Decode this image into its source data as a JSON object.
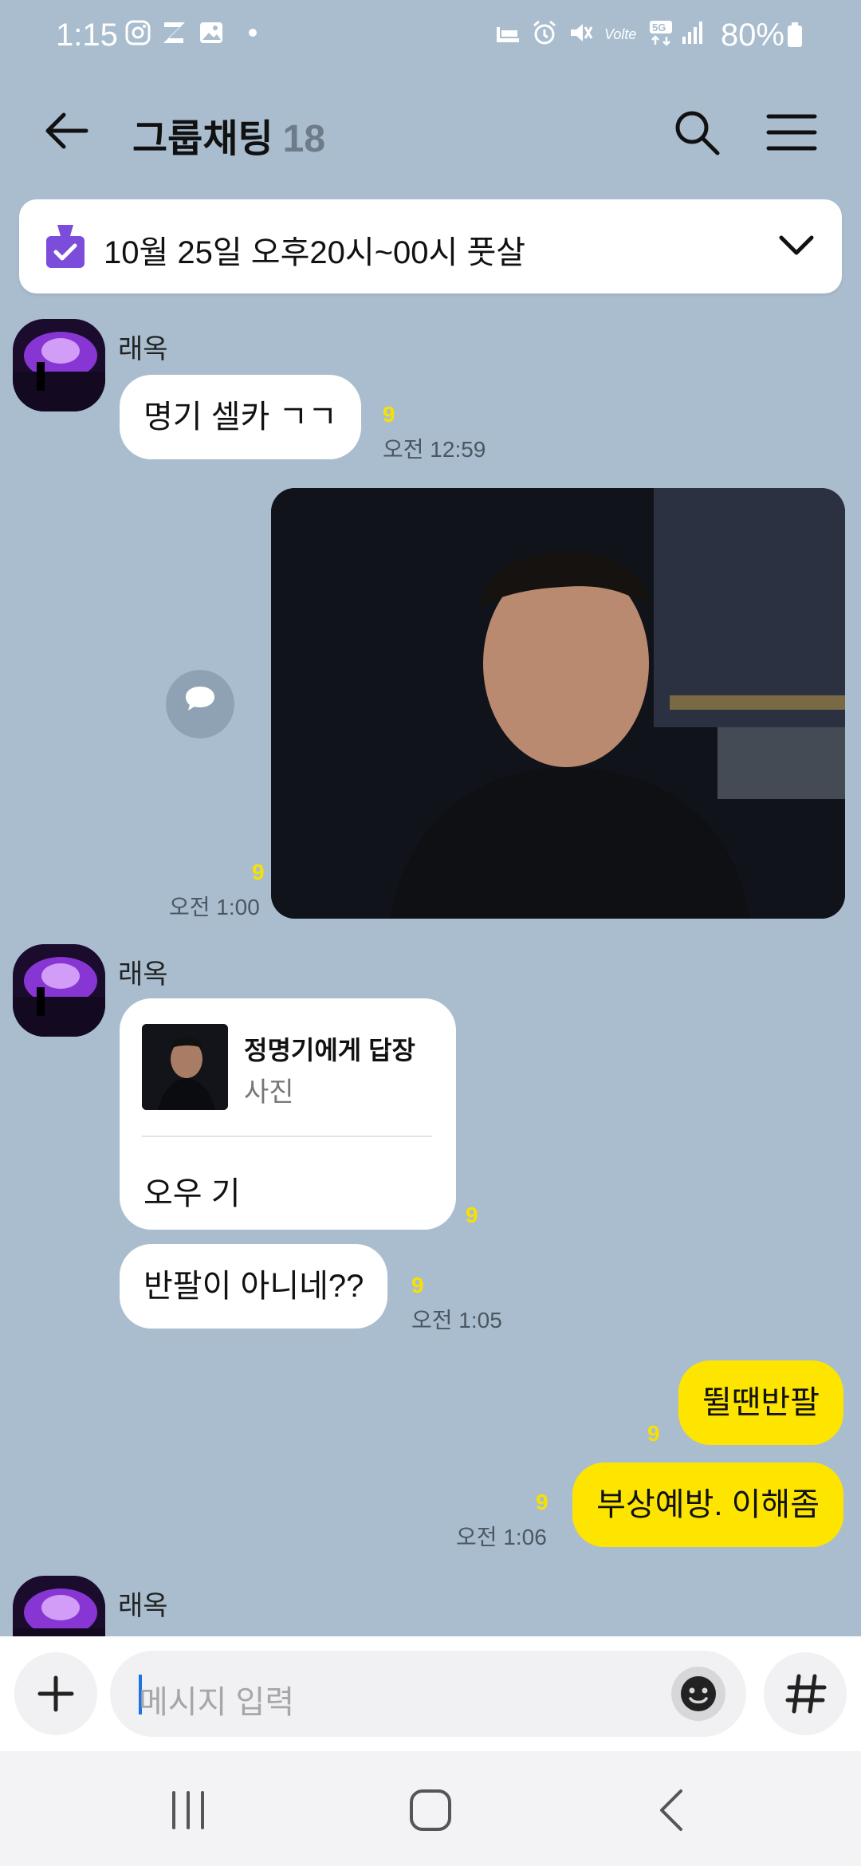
{
  "status_bar": {
    "time": "1:15",
    "battery": "80%"
  },
  "header": {
    "title": "그룹채팅",
    "member_count": "18"
  },
  "notice": {
    "text": "10월 25일 오후20시~00시 풋살"
  },
  "messages": [
    {
      "sender": "래옥",
      "text": "명기 셀카 ㄱㄱ",
      "unread": "9",
      "time": "오전 12:59"
    },
    {
      "kind": "photo",
      "unread": "9",
      "time": "오전 1:00"
    },
    {
      "sender": "래옥",
      "reply_to": "정명기에게 답장",
      "reply_type": "사진",
      "text": "오우 기",
      "unread": "9"
    },
    {
      "text": "반팔이 아니네??",
      "unread": "9",
      "time": "오전 1:05"
    },
    {
      "mine": true,
      "text": "뛸땐반팔",
      "unread": "9"
    },
    {
      "mine": true,
      "text": "부상예방. 이해좀",
      "unread": "9",
      "time": "오전 1:06"
    },
    {
      "sender": "래옥"
    }
  ],
  "input": {
    "placeholder": "메시지 입력"
  },
  "colors": {
    "background": "#a9bdcf",
    "my_bubble": "#fee500",
    "unread": "#f7e100",
    "notice_icon": "#7c4ddb"
  }
}
